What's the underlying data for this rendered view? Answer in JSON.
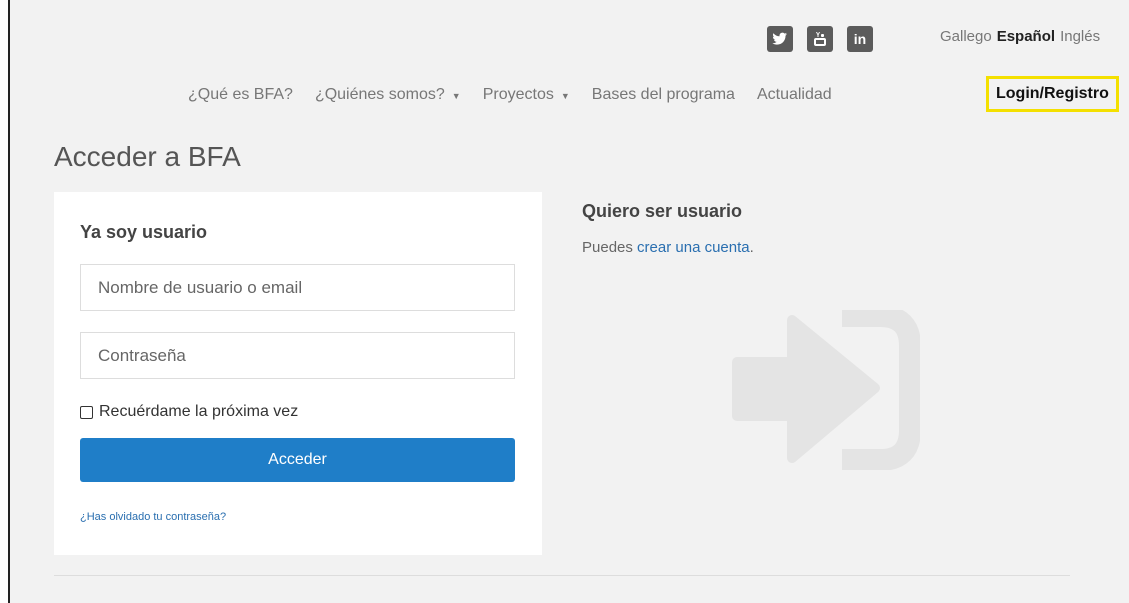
{
  "social": {
    "twitter_label": "twitter",
    "youtube_label": "You",
    "linkedin_label": "in"
  },
  "languages": {
    "galician": "Gallego",
    "spanish": "Español",
    "english": "Inglés",
    "active": "Español"
  },
  "nav": {
    "items": [
      {
        "label": "¿Qué es BFA?"
      },
      {
        "label": "¿Quiénes somos?"
      },
      {
        "label": "Proyectos"
      },
      {
        "label": "Bases del programa"
      },
      {
        "label": "Actualidad"
      }
    ],
    "login": "Login/Registro"
  },
  "page_title": "Acceder a BFA",
  "login_card": {
    "heading": "Ya soy usuario",
    "username_placeholder": "Nombre de usuario o email",
    "password_placeholder": "Contraseña",
    "remember_label": "Recuérdame la próxima vez",
    "submit_label": "Acceder",
    "forgot_label": "¿Has olvidado tu contraseña?"
  },
  "register": {
    "heading": "Quiero ser usuario",
    "text_prefix": "Puedes ",
    "link_label": "crear una cuenta",
    "text_suffix": "."
  },
  "colors": {
    "accent": "#1f7ec8",
    "highlight": "#f4e000",
    "link": "#2a6fb0"
  }
}
